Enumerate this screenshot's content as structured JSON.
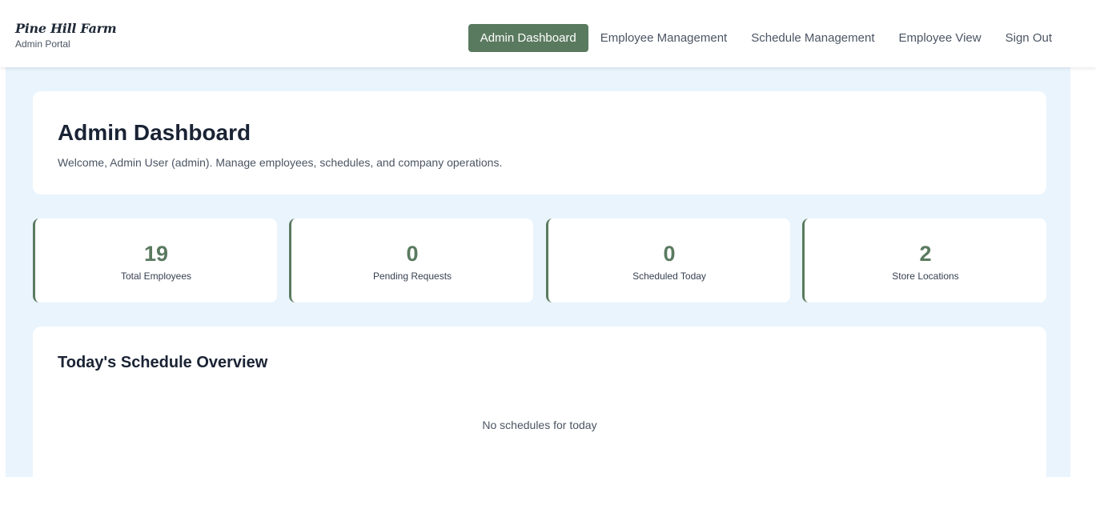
{
  "brand": {
    "name": "Pine Hill Farm",
    "subtitle": "Admin Portal"
  },
  "nav": {
    "items": [
      {
        "label": "Admin Dashboard",
        "active": true
      },
      {
        "label": "Employee Management"
      },
      {
        "label": "Schedule Management"
      },
      {
        "label": "Employee View"
      },
      {
        "label": "Sign Out"
      }
    ]
  },
  "header": {
    "title": "Admin Dashboard",
    "welcome": "Welcome, Admin User (admin). Manage employees, schedules, and company operations."
  },
  "stats": [
    {
      "value": "19",
      "label": "Total Employees"
    },
    {
      "value": "0",
      "label": "Pending Requests"
    },
    {
      "value": "0",
      "label": "Scheduled Today"
    },
    {
      "value": "2",
      "label": "Store Locations"
    }
  ],
  "overview": {
    "title": "Today's Schedule Overview",
    "empty_message": "No schedules for today"
  },
  "colors": {
    "accent": "#5a7a5f",
    "background": "#e9f4fd",
    "card": "#ffffff",
    "heading": "#1a2334"
  }
}
